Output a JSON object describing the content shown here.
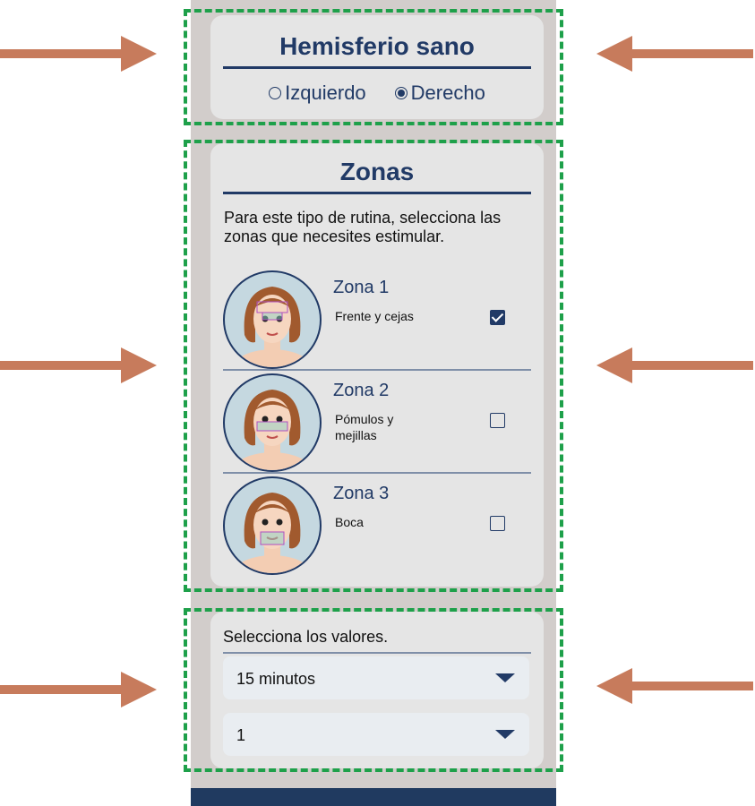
{
  "hemisferio": {
    "title": "Hemisferio sano",
    "options": [
      {
        "label": "Izquierdo",
        "selected": false
      },
      {
        "label": "Derecho",
        "selected": true
      }
    ]
  },
  "zonas": {
    "title": "Zonas",
    "description": "Para este tipo de rutina, selecciona las zonas que necesites estimular.",
    "items": [
      {
        "title": "Zona 1",
        "subtitle": "Frente y cejas",
        "checked": true
      },
      {
        "title": "Zona 2",
        "subtitle": "Pómulos y mejillas",
        "checked": false
      },
      {
        "title": "Zona 3",
        "subtitle": "Boca",
        "checked": false
      }
    ]
  },
  "valores": {
    "label": "Selecciona los valores.",
    "duration_value": "15 minutos",
    "count_value": "1"
  },
  "colors": {
    "accent": "#213a66",
    "dashed_outline": "#1ea04a",
    "arrow": "#c77b5c"
  }
}
